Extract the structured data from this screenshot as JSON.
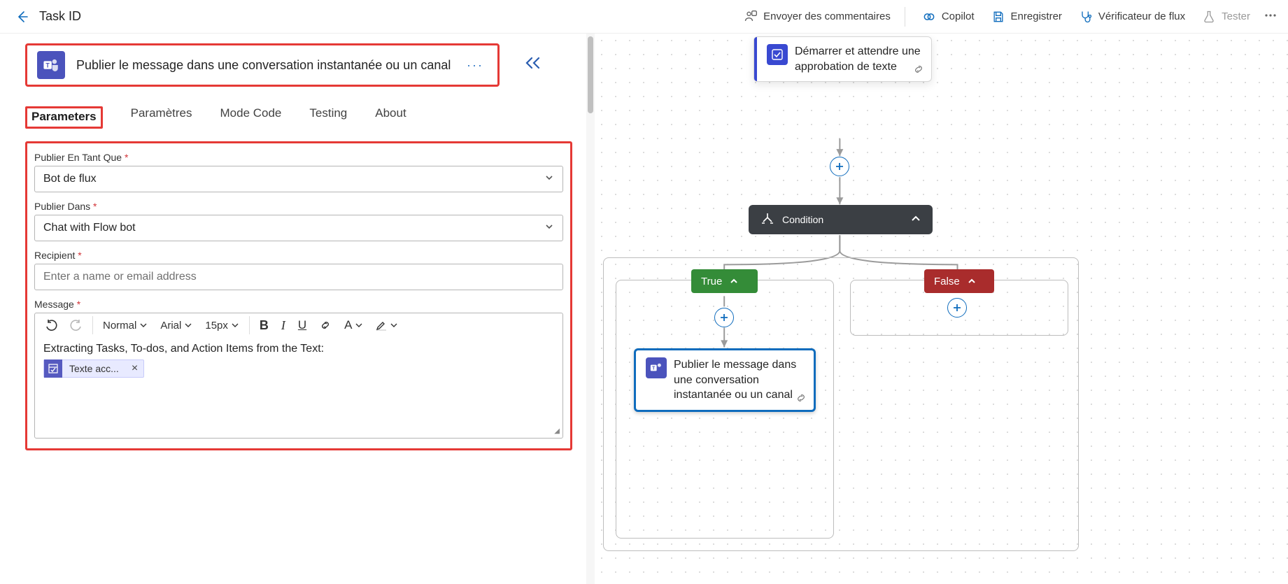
{
  "header": {
    "title": "Task ID",
    "feedback": "Envoyer des commentaires",
    "copilot": "Copilot",
    "save": "Enregistrer",
    "checker": "Vérificateur de flux",
    "test": "Tester"
  },
  "action": {
    "title": "Publier le message dans une conversation instantanée ou un canal"
  },
  "tabs": {
    "parameters": "Parameters",
    "settings": "Paramètres",
    "codeview": "Mode Code",
    "testing": "Testing",
    "about": "About"
  },
  "form": {
    "publishAs": {
      "label": "Publier En Tant Que",
      "value": "Bot de flux"
    },
    "publishIn": {
      "label": "Publier Dans",
      "value": "Chat with Flow bot"
    },
    "recipient": {
      "label": "Recipient",
      "placeholder": "Enter a name or email address"
    },
    "message": {
      "label": "Message",
      "toolbar": {
        "format": "Normal",
        "font": "Arial",
        "size": "15px"
      },
      "body_line1": "Extracting Tasks, To-dos, and Action Items from the Text:",
      "token": "Texte acc..."
    }
  },
  "canvas": {
    "approval": "Démarrer et attendre une approbation de texte",
    "condition": "Condition",
    "true": "True",
    "false": "False",
    "teamsPost": "Publier le message dans une conversation instantanée ou un canal"
  }
}
